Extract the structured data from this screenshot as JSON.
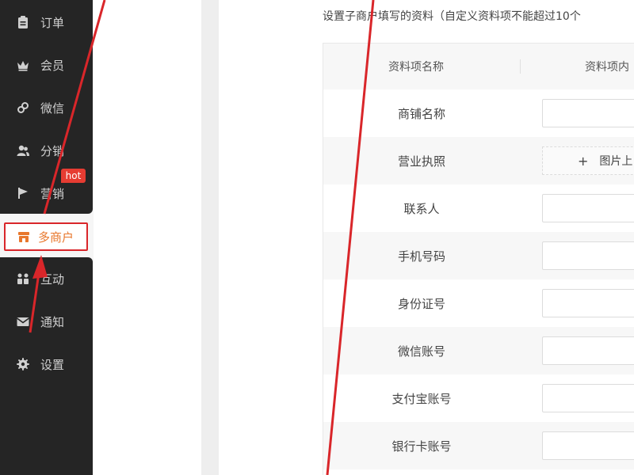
{
  "sidebar": {
    "items": [
      {
        "label": "订单",
        "icon": "clipboard-icon"
      },
      {
        "label": "会员",
        "icon": "crown-icon"
      },
      {
        "label": "微信",
        "icon": "link-icon"
      },
      {
        "label": "分销",
        "icon": "users-icon"
      },
      {
        "label": "营销",
        "icon": "flag-icon",
        "badge": "hot"
      },
      {
        "label": "多商户",
        "icon": "shop-icon",
        "active": true
      },
      {
        "label": "互动",
        "icon": "group-icon"
      },
      {
        "label": "通知",
        "icon": "mail-icon"
      },
      {
        "label": "设置",
        "icon": "gear-icon"
      }
    ]
  },
  "main": {
    "description": "设置子商户填写的资料（自定义资料项不能超过10个",
    "table": {
      "headers": [
        "资料项名称",
        "资料项内"
      ],
      "rows": [
        {
          "name": "商铺名称",
          "type": "input"
        },
        {
          "name": "营业执照",
          "type": "upload",
          "button": "图片上"
        },
        {
          "name": "联系人",
          "type": "input"
        },
        {
          "name": "手机号码",
          "type": "input"
        },
        {
          "name": "身份证号",
          "type": "input"
        },
        {
          "name": "微信账号",
          "type": "input"
        },
        {
          "name": "支付宝账号",
          "type": "input"
        },
        {
          "name": "银行卡账号",
          "type": "input"
        }
      ]
    }
  },
  "colors": {
    "sidebar_bg": "#252525",
    "active_text": "#e8772c",
    "annotation_red": "#d9262a",
    "badge_bg": "#e63c32"
  }
}
